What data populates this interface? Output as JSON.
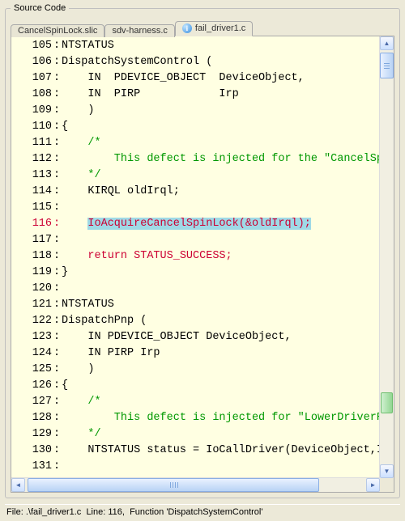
{
  "groupbox_title": "Source Code",
  "tabs": [
    {
      "label": "CancelSpinLock.slic",
      "icon": null,
      "active": false
    },
    {
      "label": "sdv-harness.c",
      "icon": null,
      "active": false
    },
    {
      "label": "fail_driver1.c",
      "icon": "info-icon",
      "active": true
    }
  ],
  "status": {
    "file": "File: .\\fail_driver1.c",
    "line": "Line: 116,",
    "func": "Function 'DispatchSystemControl'"
  },
  "code": {
    "lines": [
      {
        "n": 105,
        "cls": "",
        "text": "NTSTATUS"
      },
      {
        "n": 106,
        "cls": "",
        "text": "DispatchSystemControl ("
      },
      {
        "n": 107,
        "cls": "",
        "text": "    IN  PDEVICE_OBJECT  DeviceObject,"
      },
      {
        "n": 108,
        "cls": "",
        "text": "    IN  PIRP            Irp"
      },
      {
        "n": 109,
        "cls": "",
        "text": "    )"
      },
      {
        "n": 110,
        "cls": "",
        "text": "{"
      },
      {
        "n": 111,
        "cls": "comment",
        "text": "    /*"
      },
      {
        "n": 112,
        "cls": "comment",
        "text": "        This defect is injected for the \"CancelSpinL"
      },
      {
        "n": 113,
        "cls": "comment",
        "text": "    */"
      },
      {
        "n": 114,
        "cls": "",
        "text": "    KIRQL oldIrql;"
      },
      {
        "n": 115,
        "cls": "",
        "text": ""
      },
      {
        "n": 116,
        "cls": "kw-red",
        "text": "    IoAcquireCancelSpinLock(&oldIrql);",
        "highlight": true
      },
      {
        "n": 117,
        "cls": "",
        "text": ""
      },
      {
        "n": 118,
        "cls": "kw-red",
        "text": "    return STATUS_SUCCESS;"
      },
      {
        "n": 119,
        "cls": "",
        "text": "}"
      },
      {
        "n": 120,
        "cls": "",
        "text": ""
      },
      {
        "n": 121,
        "cls": "",
        "text": "NTSTATUS"
      },
      {
        "n": 122,
        "cls": "",
        "text": "DispatchPnp ("
      },
      {
        "n": 123,
        "cls": "",
        "text": "    IN PDEVICE_OBJECT DeviceObject,"
      },
      {
        "n": 124,
        "cls": "",
        "text": "    IN PIRP Irp"
      },
      {
        "n": 125,
        "cls": "",
        "text": "    )"
      },
      {
        "n": 126,
        "cls": "",
        "text": "{"
      },
      {
        "n": 127,
        "cls": "comment",
        "text": "    /*"
      },
      {
        "n": 128,
        "cls": "comment",
        "text": "        This defect is injected for \"LowerDriverRetu"
      },
      {
        "n": 129,
        "cls": "comment",
        "text": "    */"
      },
      {
        "n": 130,
        "cls": "",
        "text": "    NTSTATUS status = IoCallDriver(DeviceObject,Irp"
      },
      {
        "n": 131,
        "cls": "",
        "text": ""
      }
    ]
  },
  "scroll": {
    "v_marker_top_px": 440
  }
}
